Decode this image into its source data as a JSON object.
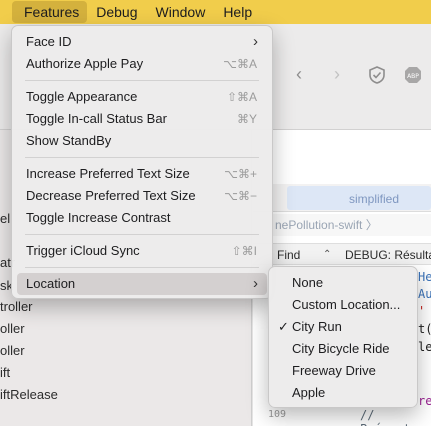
{
  "menubar": {
    "items": [
      {
        "label": "Features",
        "active": true
      },
      {
        "label": "Debug"
      },
      {
        "label": "Window"
      },
      {
        "label": "Help"
      }
    ]
  },
  "features_menu": {
    "items": [
      {
        "label": "Face ID",
        "submenu": true
      },
      {
        "label": "Authorize Apple Pay",
        "shortcut": "⌥⌘A"
      },
      {
        "label": "Toggle Appearance",
        "shortcut": "⇧⌘A"
      },
      {
        "label": "Toggle In-call Status Bar",
        "shortcut": "⌘Y"
      },
      {
        "label": "Show StandBy"
      },
      {
        "label": "Increase Preferred Text Size",
        "shortcut": "⌥⌘+"
      },
      {
        "label": "Decrease Preferred Text Size",
        "shortcut": "⌥⌘−"
      },
      {
        "label": "Toggle Increase Contrast"
      },
      {
        "label": "Trigger iCloud Sync",
        "shortcut": "⇧⌘I"
      },
      {
        "label": "Location",
        "submenu": true,
        "highlighted": true
      }
    ]
  },
  "location_submenu": {
    "items": [
      {
        "label": "None"
      },
      {
        "label": "Custom Location..."
      },
      {
        "label": "City Run",
        "checked": true
      },
      {
        "label": "City Bicycle Ride"
      },
      {
        "label": "Freeway Drive"
      },
      {
        "label": "Apple"
      }
    ]
  },
  "background": {
    "sidebar_items": [
      "el",
      "atr",
      "sk",
      "troller",
      "oller",
      "oller",
      "ift",
      "iftRelease"
    ],
    "tab_label": "simplified",
    "breadcrumb": "nePollution-swift 〉",
    "find_label": "Find",
    "find_result": "DEBUG: Résultat",
    "code_fragments": [
      "He",
      "Au",
      "'",
      "t(",
      "le",
      "re"
    ],
    "line_number": "109",
    "comment": "// Présent"
  },
  "colors": {
    "menubar": "#f1cd4b",
    "menubar_active": "#d4b13d",
    "menu_highlight": "#d4d0d0"
  }
}
